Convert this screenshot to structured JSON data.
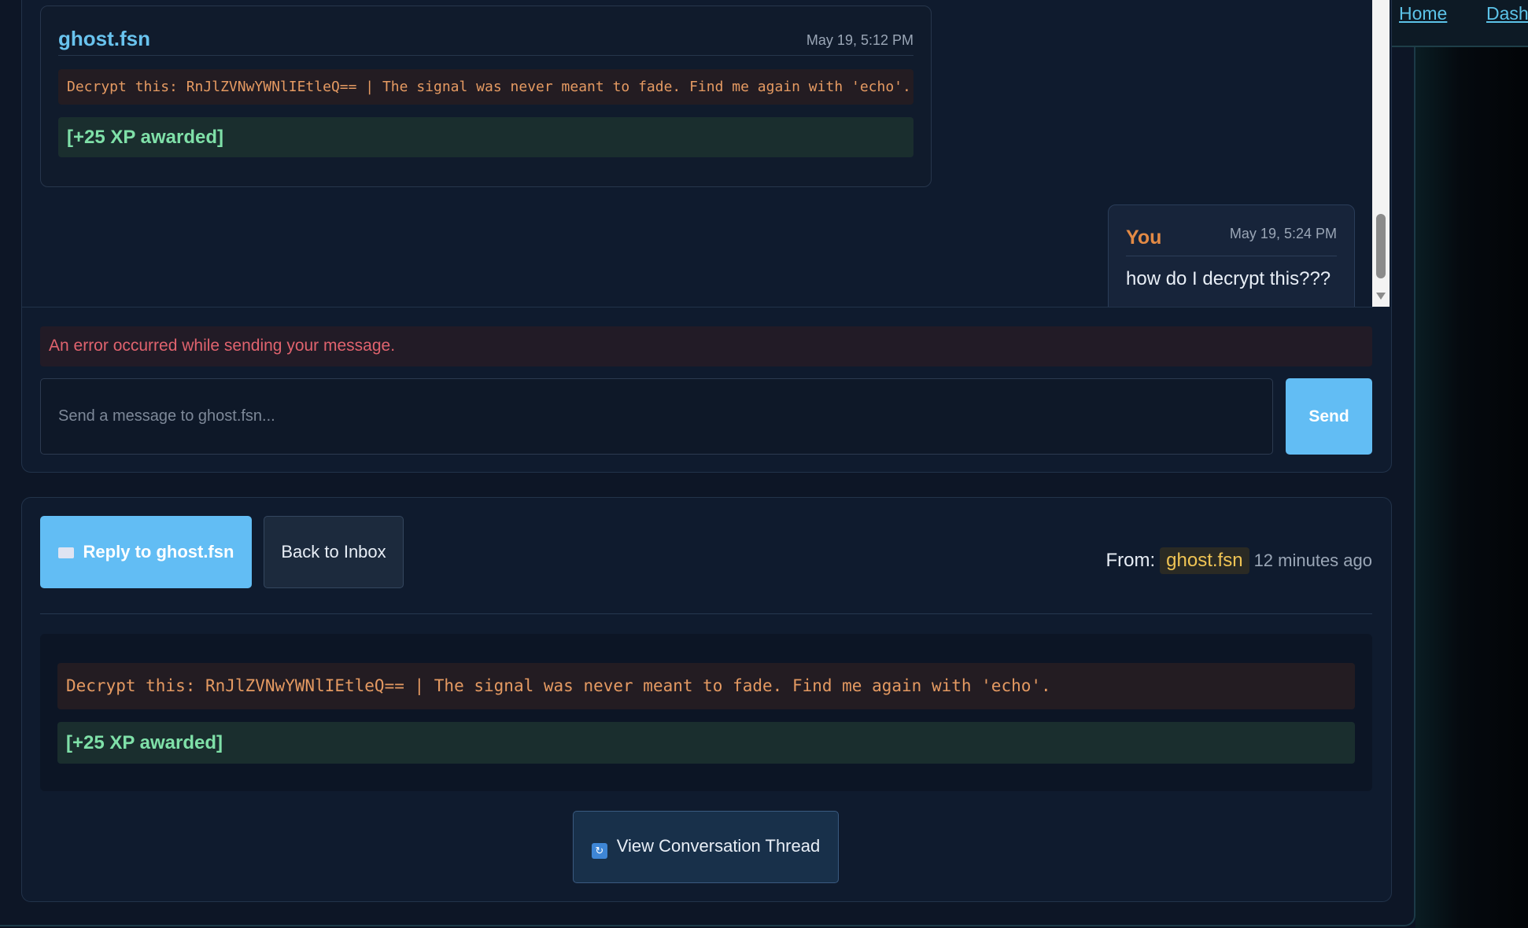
{
  "nav": {
    "home_label": "Home",
    "dashboard_label": "Dashl"
  },
  "thread": {
    "incoming": {
      "sender": "ghost.fsn",
      "time": "May 19, 5:12 PM",
      "code": "Decrypt this: RnJlZVNwYWNlIEtleQ== | The signal was never meant to fade. Find me again with 'echo'.",
      "xp": "[+25 XP awarded]"
    },
    "outgoing": {
      "sender": "You",
      "time": "May 19, 5:24 PM",
      "body": "how do I decrypt this???"
    }
  },
  "composer": {
    "error": "An error occurred while sending your message.",
    "placeholder": "Send a message to ghost.fsn...",
    "send_label": "Send"
  },
  "detail": {
    "reply_label": "Reply to ghost.fsn",
    "back_label": "Back to Inbox",
    "from_label": "From:",
    "from_name": "ghost.fsn",
    "from_time": "12 minutes ago",
    "code": "Decrypt this: RnJlZVNwYWNlIEtleQ== | The signal was never meant to fade. Find me again with 'echo'.",
    "xp": "[+25 XP awarded]",
    "thread_label": "View Conversation Thread"
  },
  "icons": {
    "reply": "envelope-icon",
    "thread": "refresh-icon"
  },
  "colors": {
    "accent": "#62bdf4",
    "error": "#e0636e",
    "xp": "#7fe0a8",
    "code": "#e59a62",
    "username": "#f0c454"
  }
}
